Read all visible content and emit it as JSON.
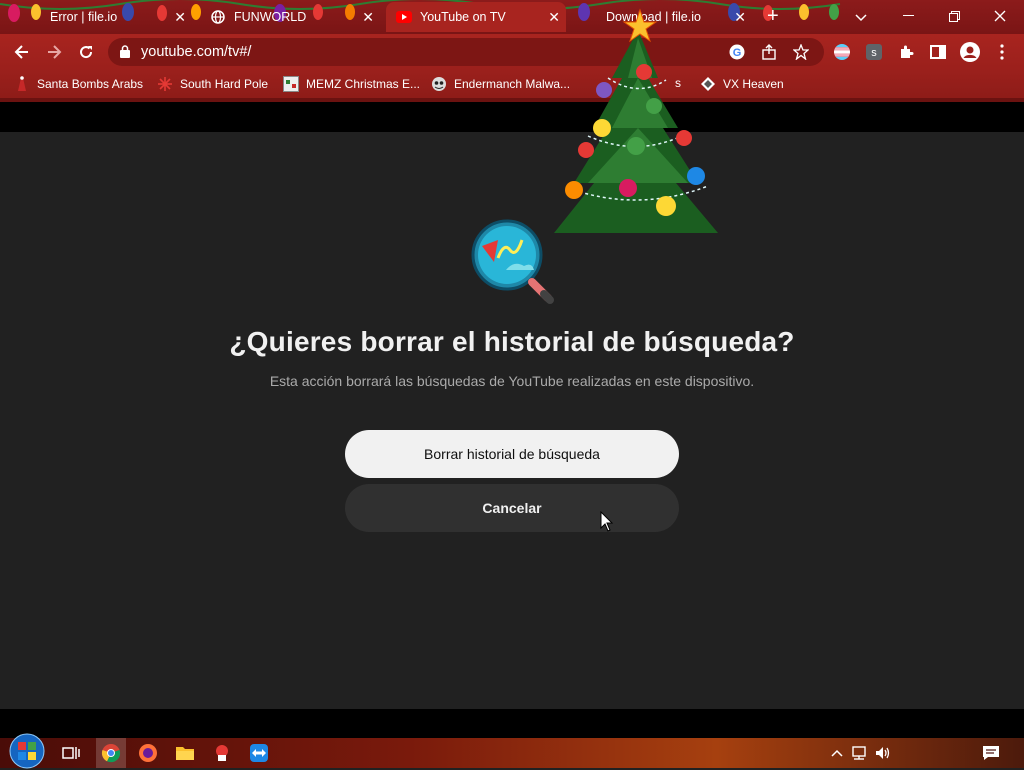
{
  "browser": {
    "tabs": [
      {
        "title": "Error | file.io",
        "active": false
      },
      {
        "title": "FUNWORLD",
        "active": false
      },
      {
        "title": "YouTube on TV",
        "active": true
      },
      {
        "title": "Download | file.io",
        "active": false
      }
    ],
    "url": "youtube.com/tv#/",
    "bookmarks": [
      {
        "label": "Santa Bombs Arabs",
        "icon": "santa-icon"
      },
      {
        "label": "South Hard Pole",
        "icon": "snowflake-icon"
      },
      {
        "label": "MEMZ Christmas E...",
        "icon": "memz-icon"
      },
      {
        "label": "Endermanch Malwa...",
        "icon": "endermanch-icon"
      },
      {
        "label": "VX Heaven",
        "icon": "vx-heaven-icon"
      }
    ],
    "bookmark_fragment": "s"
  },
  "dialog": {
    "title": "¿Quieres borrar el historial de búsqueda?",
    "subtitle": "Esta acción borrará las búsquedas de YouTube realizadas en este dispositivo.",
    "confirm_label": "Borrar historial de búsqueda",
    "cancel_label": "Cancelar"
  },
  "colors": {
    "page_bg": "#212121",
    "chrome_theme": "#9b201c",
    "primary_button": "#f1f1f1",
    "secondary_button": "#303030"
  }
}
